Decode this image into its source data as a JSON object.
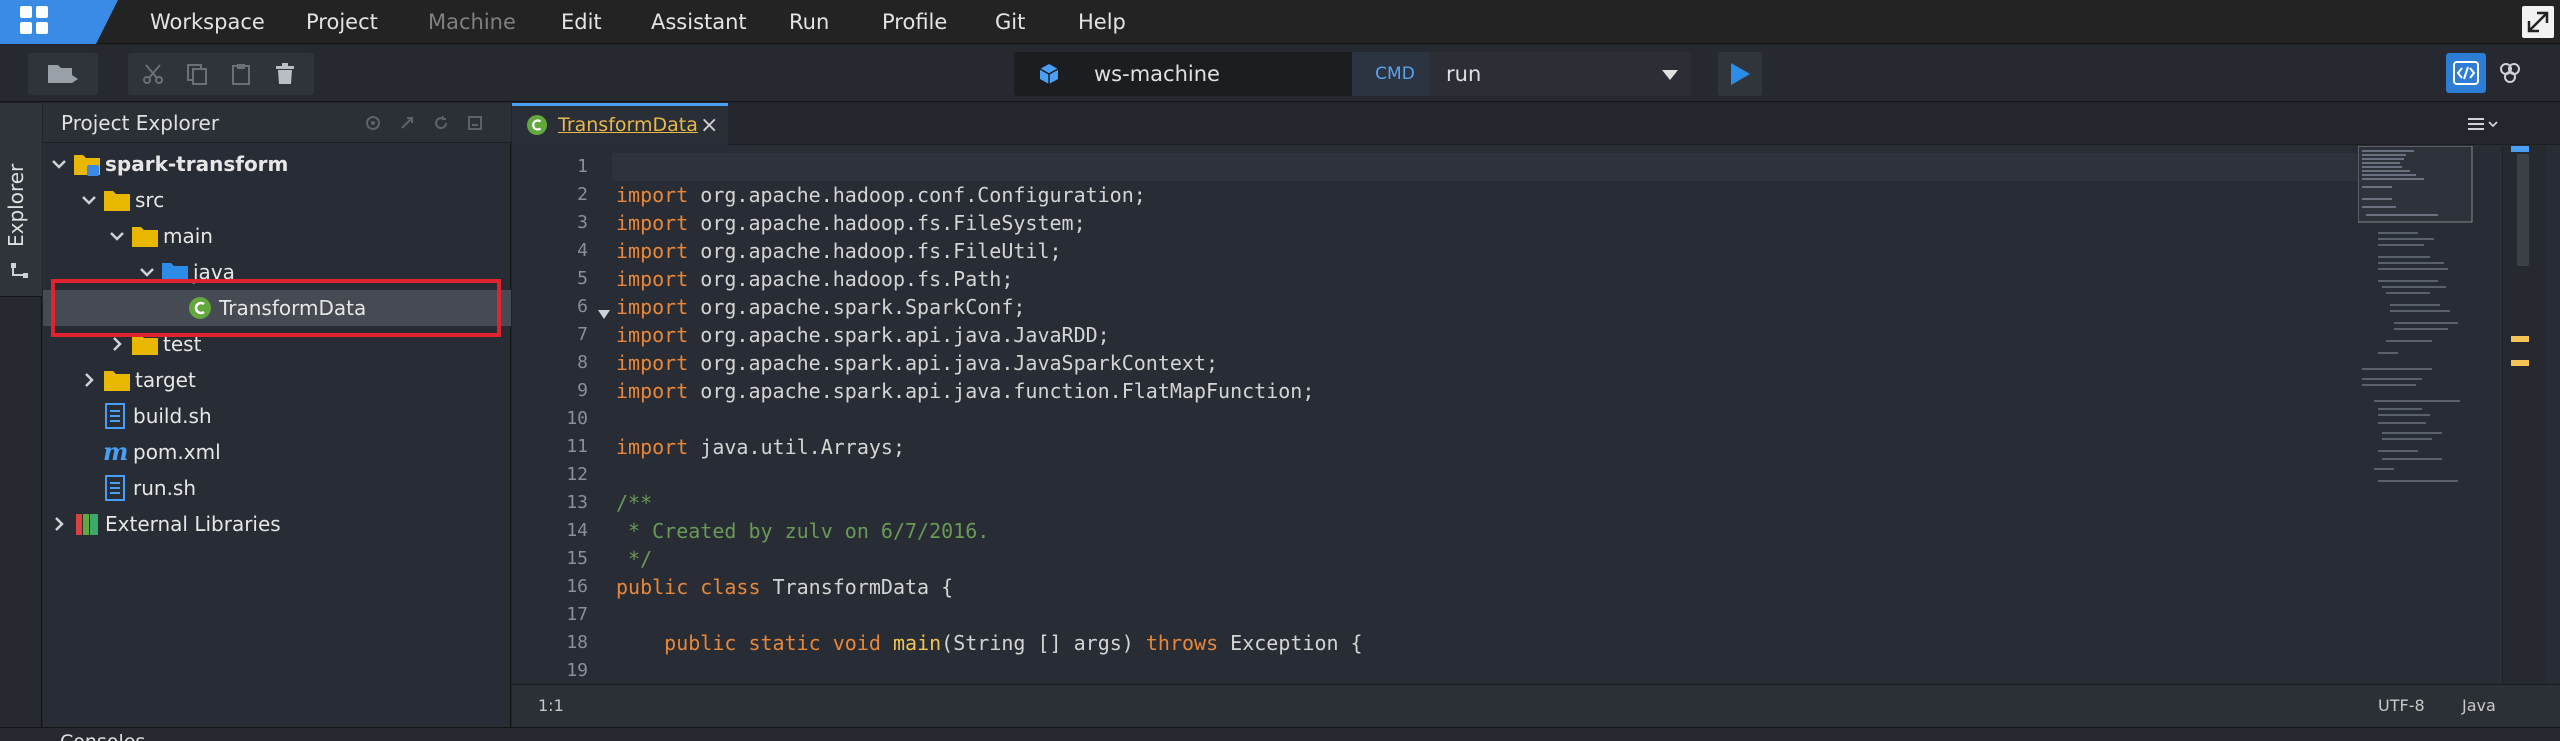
{
  "menubar": {
    "items": [
      "Workspace",
      "Project",
      "Machine",
      "Edit",
      "Assistant",
      "Run",
      "Profile",
      "Git",
      "Help"
    ],
    "disabled": [
      "Machine"
    ]
  },
  "toolbar": {
    "machine_name": "ws-machine",
    "cmd_badge": "CMD",
    "cmd_value": "run"
  },
  "sidebar": {
    "tab_label": "Explorer"
  },
  "explorer": {
    "title": "Project Explorer",
    "tree": [
      {
        "label": "spark-transform",
        "type": "project",
        "expanded": true,
        "bold": true
      },
      {
        "label": "src",
        "type": "folder",
        "expanded": true
      },
      {
        "label": "main",
        "type": "folder",
        "expanded": true
      },
      {
        "label": "java",
        "type": "package-folder",
        "expanded": true
      },
      {
        "label": "TransformData",
        "type": "java-class",
        "selected": true
      },
      {
        "label": "test",
        "type": "folder",
        "expanded": false
      },
      {
        "label": "target",
        "type": "folder",
        "expanded": false
      },
      {
        "label": "build.sh",
        "type": "file"
      },
      {
        "label": "pom.xml",
        "type": "maven-file"
      },
      {
        "label": "run.sh",
        "type": "file"
      },
      {
        "label": "External Libraries",
        "type": "library",
        "expanded": false
      }
    ]
  },
  "editor": {
    "tab_label": "TransformData",
    "tab_close": "×",
    "line_numbers": [
      "1",
      "2",
      "3",
      "4",
      "5",
      "6",
      "7",
      "8",
      "9",
      "10",
      "11",
      "12",
      "13",
      "14",
      "15",
      "16",
      "17",
      "18",
      "19"
    ],
    "lines": [
      "",
      "import org.apache.hadoop.conf.Configuration;",
      "import org.apache.hadoop.fs.FileSystem;",
      "import org.apache.hadoop.fs.FileUtil;",
      "import org.apache.hadoop.fs.Path;",
      "import org.apache.spark.SparkConf;",
      "import org.apache.spark.api.java.JavaRDD;",
      "import org.apache.spark.api.java.JavaSparkContext;",
      "import org.apache.spark.api.java.function.FlatMapFunction;",
      "",
      "import java.util.Arrays;",
      "",
      "/**",
      " * Created by zulv on 6/7/2016.",
      " */",
      "public class TransformData {",
      "",
      "    public static void main(String [] args) throws Exception {",
      ""
    ]
  },
  "status": {
    "cursor": "1:1",
    "encoding": "UTF-8",
    "language": "Java"
  },
  "consoles": {
    "label": "Consoles"
  },
  "colors": {
    "accent": "#2d7cd5",
    "keyword": "#e8873a",
    "comment": "#6a9955",
    "method": "#f3c455",
    "selection_outline": "#e0232f"
  }
}
